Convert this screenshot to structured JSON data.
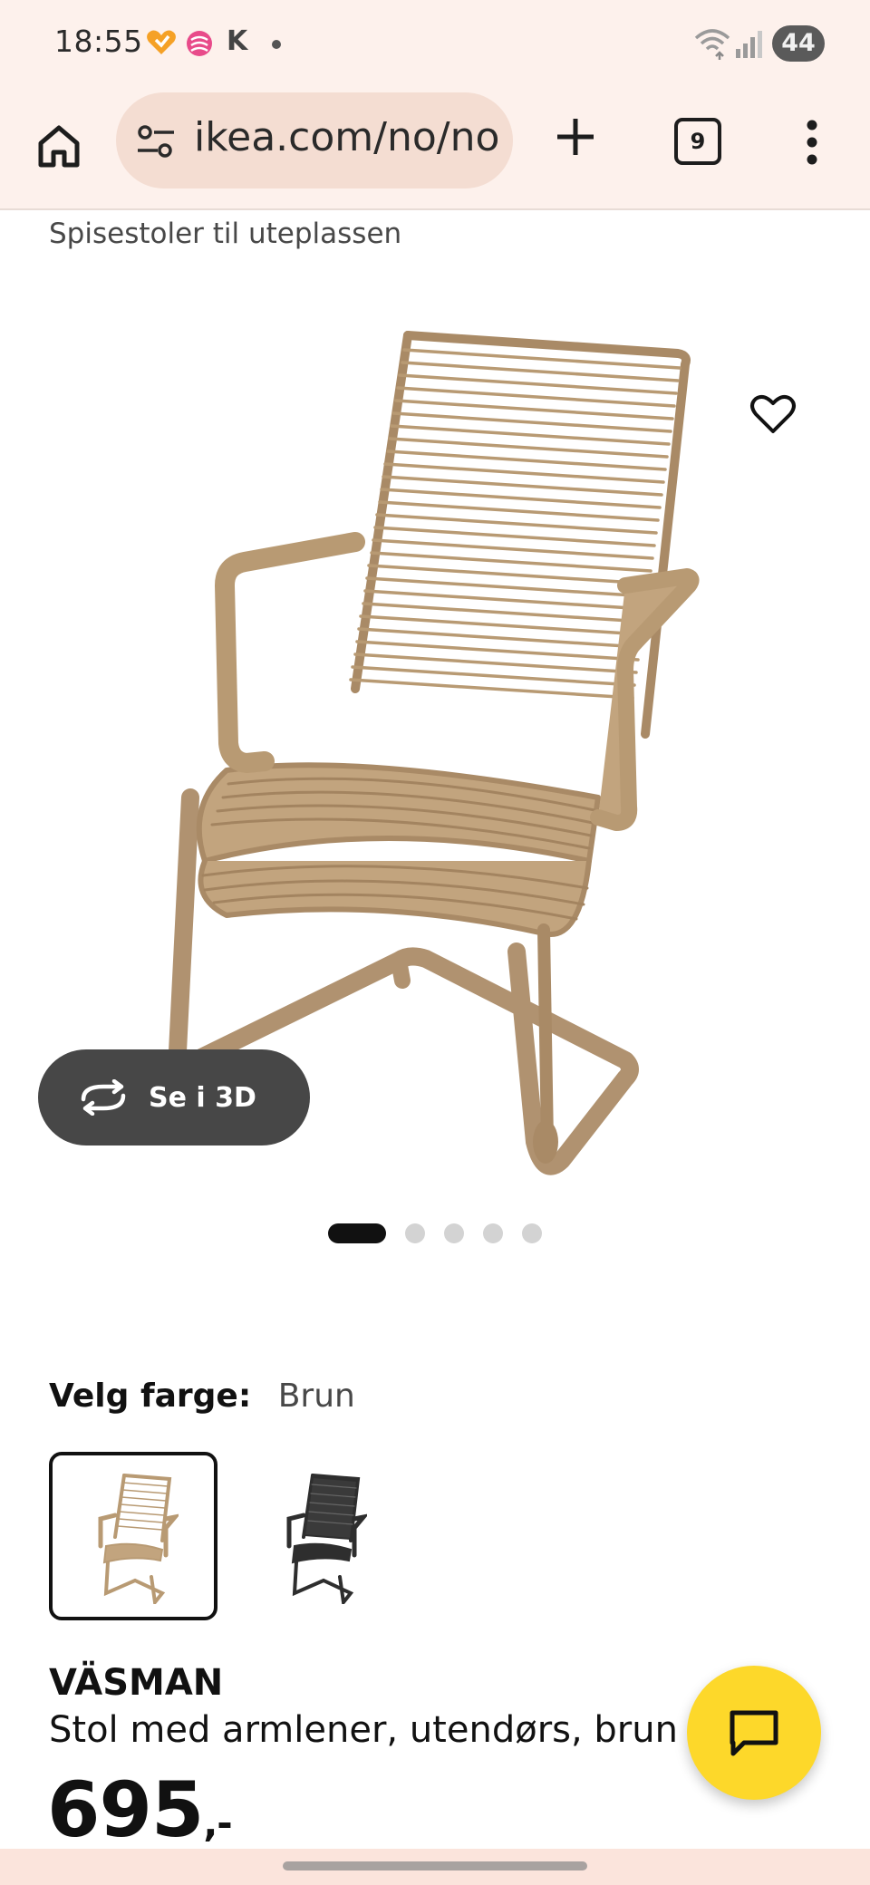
{
  "status_bar": {
    "time": "18:55",
    "carrier_letter": "K",
    "battery": "44"
  },
  "browser": {
    "url": "ikea.com/no/no",
    "tab_count": "9"
  },
  "breadcrumb": "Spisestoler til uteplassen",
  "gallery": {
    "view_3d_label": "Se i 3D",
    "image_count": 5,
    "active_index": 0
  },
  "color_picker": {
    "label": "Velg farge:",
    "selected_value": "Brun"
  },
  "product": {
    "name": "VÄSMAN",
    "description": "Stol med armlener, utendørs, brun",
    "price": "695",
    "price_suffix": ",-"
  },
  "colors": {
    "chair_brown": "#b89a73",
    "chair_brown_dark": "#9c7f5a",
    "chair_black": "#2e2e2e",
    "chat_yellow": "#fdd82a",
    "toolbar_bg": "#fdf1ec"
  }
}
